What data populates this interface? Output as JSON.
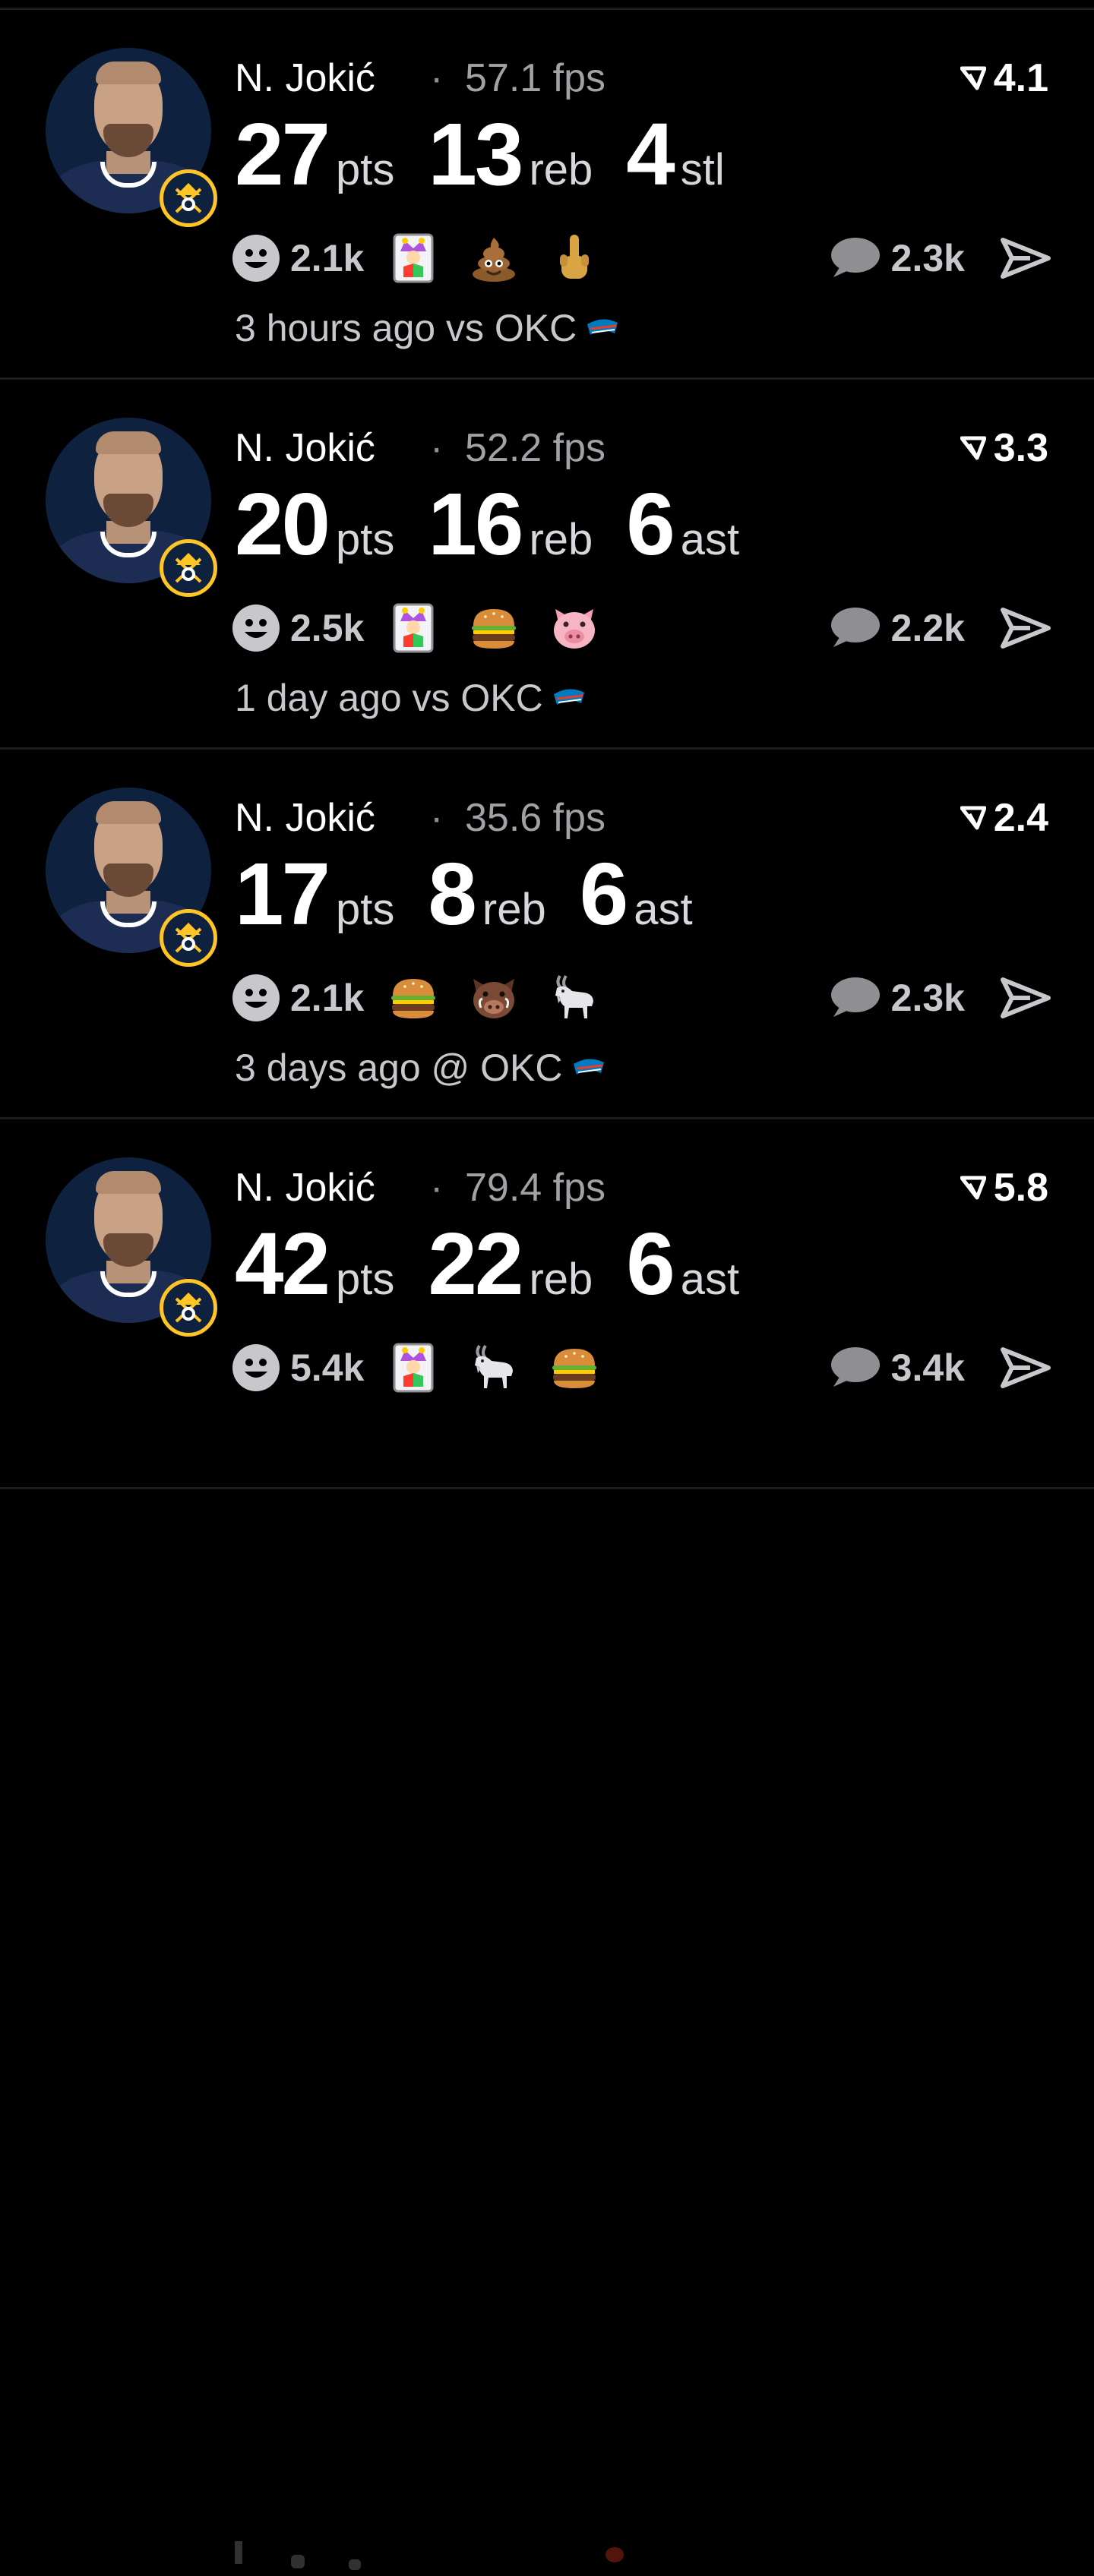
{
  "colors": {
    "background": "#000000",
    "divider": "#1c1c1e",
    "muted_text": "#a1a1a6",
    "icon_gray": "#c7c7cc",
    "nuggets_gold": "#fec524",
    "nuggets_navy": "#0e2240",
    "thunder_blue": "#007ac1",
    "thunder_orange": "#ef3b24"
  },
  "posts": [
    {
      "player": "N. Jokić",
      "separator": "·",
      "fps": "57.1 fps",
      "rating": "4.1",
      "stats": [
        {
          "value": "27",
          "unit": "pts"
        },
        {
          "value": "13",
          "unit": "reb"
        },
        {
          "value": "4",
          "unit": "stl"
        }
      ],
      "reaction_count": "2.1k",
      "emojis": [
        "jester-card-icon",
        "poop-icon",
        "middle-finger-icon"
      ],
      "comment_count": "2.3k",
      "footer": "3 hours ago vs OKC"
    },
    {
      "player": "N. Jokić",
      "separator": "·",
      "fps": "52.2 fps",
      "rating": "3.3",
      "stats": [
        {
          "value": "20",
          "unit": "pts"
        },
        {
          "value": "16",
          "unit": "reb"
        },
        {
          "value": "6",
          "unit": "ast"
        }
      ],
      "reaction_count": "2.5k",
      "emojis": [
        "jester-card-icon",
        "burger-icon",
        "pig-icon"
      ],
      "comment_count": "2.2k",
      "footer": "1 day ago vs OKC"
    },
    {
      "player": "N. Jokić",
      "separator": "·",
      "fps": "35.6 fps",
      "rating": "2.4",
      "stats": [
        {
          "value": "17",
          "unit": "pts"
        },
        {
          "value": "8",
          "unit": "reb"
        },
        {
          "value": "6",
          "unit": "ast"
        }
      ],
      "reaction_count": "2.1k",
      "emojis": [
        "burger-icon",
        "boar-icon",
        "goat-icon"
      ],
      "comment_count": "2.3k",
      "footer": "3 days ago @ OKC"
    },
    {
      "player": "N. Jokić",
      "separator": "·",
      "fps": "79.4 fps",
      "rating": "5.8",
      "stats": [
        {
          "value": "42",
          "unit": "pts"
        },
        {
          "value": "22",
          "unit": "reb"
        },
        {
          "value": "6",
          "unit": "ast"
        }
      ],
      "reaction_count": "5.4k",
      "emojis": [
        "jester-card-icon",
        "goat-icon",
        "burger-icon"
      ],
      "comment_count": "3.4k",
      "footer": ""
    }
  ]
}
